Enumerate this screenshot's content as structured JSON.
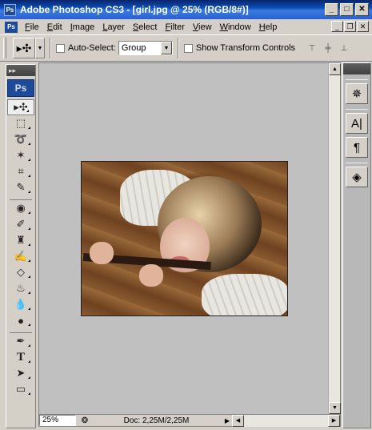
{
  "window": {
    "title": "Adobe Photoshop CS3 - [girl.jpg @ 25% (RGB/8#)]",
    "app_icon": "Ps",
    "minimize": "_",
    "maximize": "□",
    "close": "✕"
  },
  "menu": {
    "logo": "Ps",
    "items": [
      "File",
      "Edit",
      "Image",
      "Layer",
      "Select",
      "Filter",
      "View",
      "Window",
      "Help"
    ],
    "doc_minimize": "_",
    "doc_restore": "❐",
    "doc_close": "✕"
  },
  "options": {
    "auto_select_label": "Auto-Select:",
    "auto_select_value": "Group",
    "show_transform_label": "Show Transform Controls"
  },
  "toolbox": {
    "logo": "Ps",
    "tools": [
      "move",
      "marquee",
      "lasso",
      "magic-wand",
      "crop",
      "eyedropper",
      "healing",
      "brush",
      "stamp",
      "history-brush",
      "eraser",
      "paint-bucket",
      "blur",
      "dodge",
      "pen",
      "type",
      "path-select",
      "shape"
    ]
  },
  "document": {
    "filename": "girl.jpg",
    "zoom": "25%",
    "doc_info": "Doc: 2,25M/2,25M"
  },
  "dock": {
    "buttons": [
      "navigator",
      "character",
      "paragraph",
      "layers"
    ]
  },
  "colors": {
    "titlebar": "#0a4eb6",
    "chrome": "#d4d0c8",
    "canvas": "#c0c0c0"
  }
}
